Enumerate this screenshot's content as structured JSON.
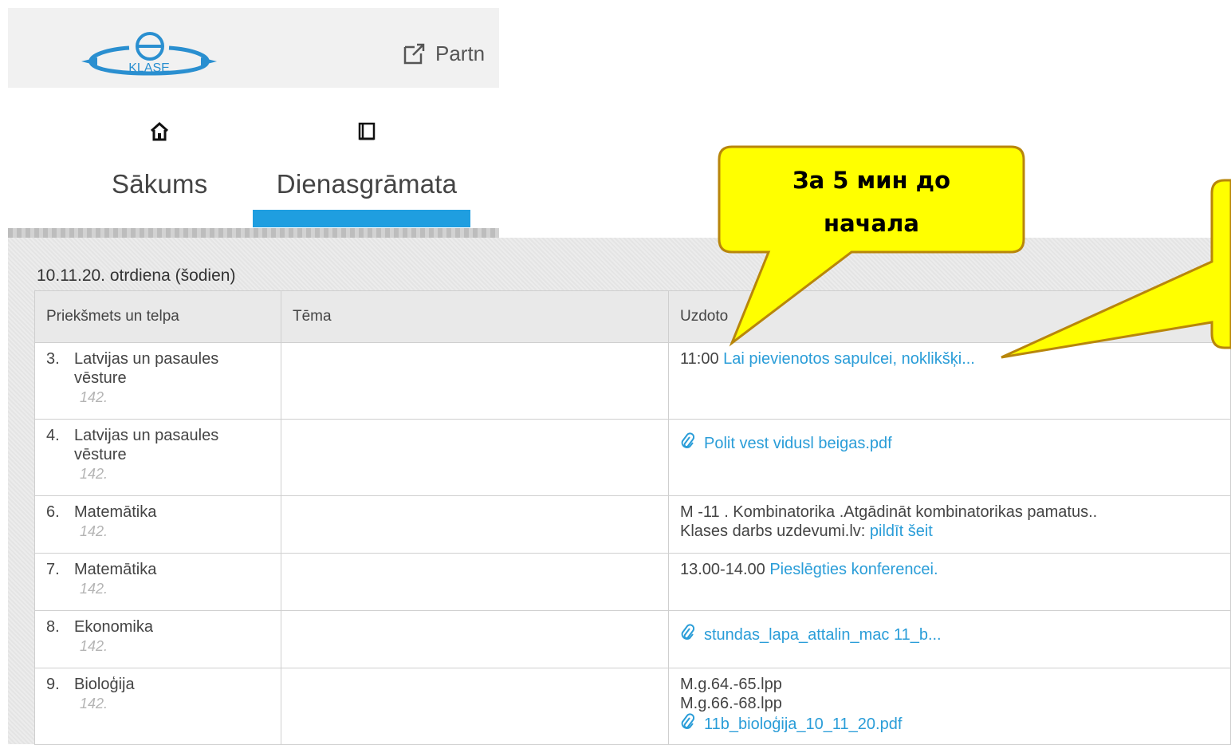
{
  "header": {
    "logo_text": "KLASE",
    "partner_label": "Partn"
  },
  "nav": {
    "home_label": "Sākums",
    "diary_label": "Dienasgrāmata"
  },
  "day": {
    "title": "10.11.20. otrdiena (šodien)"
  },
  "table": {
    "headers": [
      "Priekšmets un telpa",
      "Tēma",
      "Uzdoto"
    ],
    "rows": [
      {
        "num": "3.",
        "subject": "Latvijas un pasaules vēsture",
        "room": "142.",
        "topic": "",
        "hw_prefix": "11:00",
        "hw_link": "Lai pievienotos sapulcei, noklikšķi..."
      },
      {
        "num": "4.",
        "subject": "Latvijas un pasaules vēsture",
        "room": "142.",
        "topic": "",
        "hw_file": "Polit vest vidusl beigas.pdf"
      },
      {
        "num": "6.",
        "subject": "Matemātika",
        "room": "142.",
        "topic": "",
        "hw_line1": "M -11 . Kombinatorika .Atgādināt kombinatorikas pamatus..",
        "hw_prefix": "Klases darbs uzdevumi.lv:",
        "hw_link": "pildīt šeit"
      },
      {
        "num": "7.",
        "subject": "Matemātika",
        "room": "142.",
        "topic": "",
        "hw_prefix": "13.00-14.00",
        "hw_link": "Pieslēgties konferencei."
      },
      {
        "num": "8.",
        "subject": "Ekonomika",
        "room": "142.",
        "topic": "",
        "hw_file": "stundas_lapa_attalin_mac 11_b..."
      },
      {
        "num": "9.",
        "subject": "Bioloģija",
        "room": "142.",
        "topic": "",
        "hw_line1": "M.g.64.-65.lpp",
        "hw_line2": "M.g.66.-68.lpp",
        "hw_file": "11b_bioloģija_10_11_20.pdf"
      }
    ]
  },
  "callout": {
    "line1": "За 5 мин до",
    "line2": "начала"
  },
  "colors": {
    "accent": "#1f9ee0",
    "link": "#2a9dd8",
    "callout_fill": "#ffff00",
    "callout_stroke": "#b8860b"
  },
  "icons": [
    "external-link-icon",
    "home-icon",
    "book-icon",
    "paperclip-icon"
  ]
}
